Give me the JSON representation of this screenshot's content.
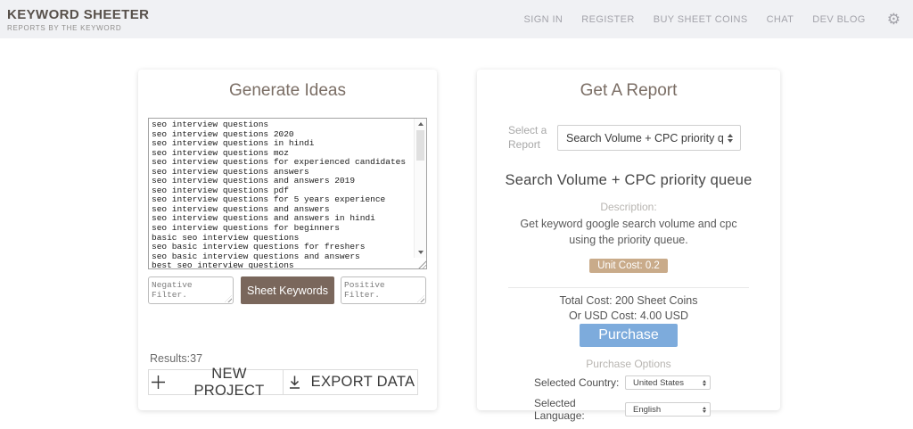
{
  "header": {
    "logo_title": "KEYWORD SHEETER",
    "logo_subtitle": "REPORTS BY THE KEYWORD",
    "nav": [
      {
        "label": "SIGN IN"
      },
      {
        "label": "REGISTER"
      },
      {
        "label": "BUY SHEET COINS"
      },
      {
        "label": "CHAT"
      },
      {
        "label": "DEV BLOG"
      }
    ],
    "gear_icon": "⚙"
  },
  "generate_ideas": {
    "title": "Generate Ideas",
    "keywords": "seo interview questions\nseo interview questions 2020\nseo interview questions in hindi\nseo interview questions moz\nseo interview questions for experienced candidates\nseo interview questions answers\nseo interview questions and answers 2019\nseo interview questions pdf\nseo interview questions for 5 years experience\nseo interview questions and answers\nseo interview questions and answers in hindi\nseo interview questions for beginners\nbasic seo interview questions\nseo basic interview questions for freshers\nseo basic interview questions and answers\nbest seo interview questions",
    "negative_filter_placeholder": "Negative Filter.",
    "sheet_keywords_label": "Sheet Keywords",
    "positive_filter_placeholder": "Positive Filter.",
    "results_label": "Results:37",
    "new_project_label": "NEW PROJECT",
    "export_data_label": "EXPORT DATA"
  },
  "get_a_report": {
    "title": "Get A Report",
    "select_label": "Select a Report",
    "selected_report": "Search Volume + CPC priority queue",
    "report_title": "Search Volume + CPC priority queue",
    "description_label": "Description:",
    "description_line1": "Get keyword google search volume and cpc",
    "description_line2": "using the priority queue.",
    "unit_cost": "Unit Cost: 0.2",
    "total_cost": "Total Cost: 200 Sheet Coins",
    "usd_cost": "Or USD Cost: 4.00 USD",
    "purchase_label": "Purchase",
    "purchase_options_label": "Purchase Options",
    "country_label": "Selected Country:",
    "country_value": "United States",
    "language_label": "Selected Language:",
    "language_value": "English"
  },
  "colors": {
    "header_background": "#f0f1f4",
    "brand_brown": "#7a675c",
    "badge_tan": "#c9ab8a",
    "purchase_blue": "#7dabdc",
    "heading_brown": "#7b6e65"
  }
}
